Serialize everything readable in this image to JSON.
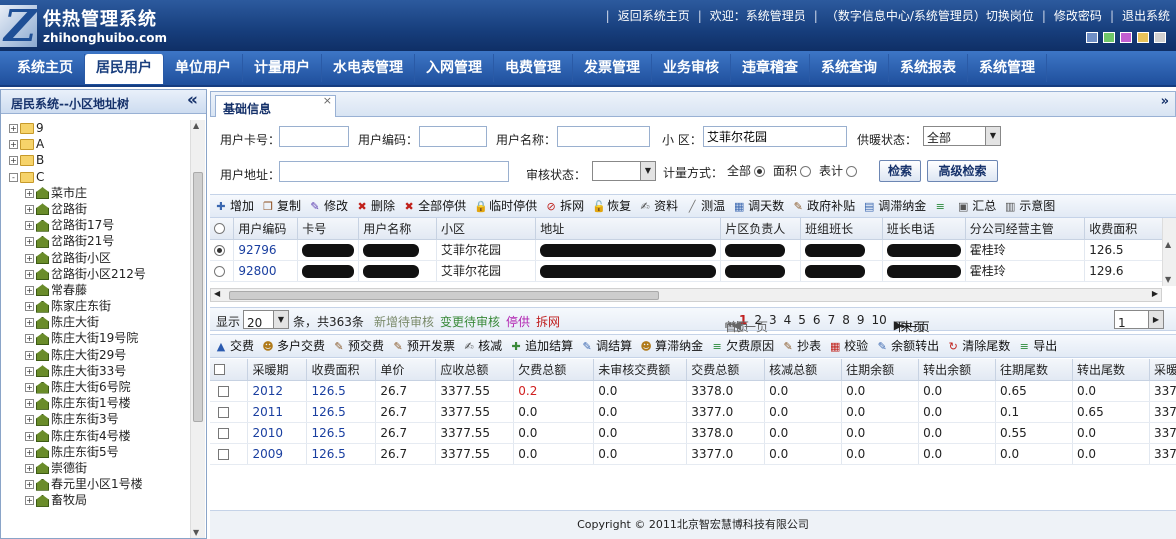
{
  "header": {
    "logo_glyph": "Z",
    "title": "供热管理系统",
    "domain": "zhihonghuibo.com",
    "links": [
      "返回系统主页",
      "欢迎：系统管理员",
      "（数字信息中心/系统管理员）切换岗位",
      "修改密码",
      "退出系统"
    ],
    "swatch_colors": [
      "#6f8fc6",
      "#6fc66a",
      "#c25fd1",
      "#e7c25b",
      "#d0d0d0"
    ]
  },
  "nav": {
    "items": [
      "系统主页",
      "居民用户",
      "单位用户",
      "计量用户",
      "水电表管理",
      "入网管理",
      "电费管理",
      "发票管理",
      "业务审核",
      "违章稽查",
      "系统查询",
      "系统报表",
      "系统管理"
    ],
    "active": "居民用户"
  },
  "sidebar": {
    "title": "居民系统--小区地址树",
    "collapse_icon": "«",
    "tree": [
      {
        "label": "9",
        "level": 0,
        "type": "folder",
        "expand": "+"
      },
      {
        "label": "A",
        "level": 0,
        "type": "folder",
        "expand": "+"
      },
      {
        "label": "B",
        "level": 0,
        "type": "folder",
        "expand": "+"
      },
      {
        "label": "C",
        "level": 0,
        "type": "folder",
        "expand": "-"
      },
      {
        "label": "菜市庄",
        "level": 1,
        "type": "house",
        "expand": "+"
      },
      {
        "label": "岔路街",
        "level": 1,
        "type": "house",
        "expand": "+"
      },
      {
        "label": "岔路街17号",
        "level": 1,
        "type": "house",
        "expand": "+"
      },
      {
        "label": "岔路街21号",
        "level": 1,
        "type": "house",
        "expand": "+"
      },
      {
        "label": "岔路街小区",
        "level": 1,
        "type": "house",
        "expand": "+"
      },
      {
        "label": "岔路街小区212号",
        "level": 1,
        "type": "house",
        "expand": "+"
      },
      {
        "label": "常春藤",
        "level": 1,
        "type": "house",
        "expand": "+"
      },
      {
        "label": "陈家庄东街",
        "level": 1,
        "type": "house",
        "expand": "+"
      },
      {
        "label": "陈庄大街",
        "level": 1,
        "type": "house",
        "expand": "+"
      },
      {
        "label": "陈庄大街19号院",
        "level": 1,
        "type": "house",
        "expand": "+"
      },
      {
        "label": "陈庄大街29号",
        "level": 1,
        "type": "house",
        "expand": "+"
      },
      {
        "label": "陈庄大街33号",
        "level": 1,
        "type": "house",
        "expand": "+"
      },
      {
        "label": "陈庄大街6号院",
        "level": 1,
        "type": "house",
        "expand": "+"
      },
      {
        "label": "陈庄东街1号楼",
        "level": 1,
        "type": "house",
        "expand": "+"
      },
      {
        "label": "陈庄东街3号",
        "level": 1,
        "type": "house",
        "expand": "+"
      },
      {
        "label": "陈庄东街4号楼",
        "level": 1,
        "type": "house",
        "expand": "+"
      },
      {
        "label": "陈庄东街5号",
        "level": 1,
        "type": "house",
        "expand": "+"
      },
      {
        "label": "崇德街",
        "level": 1,
        "type": "house",
        "expand": "+"
      },
      {
        "label": "春元里小区1号楼",
        "level": 1,
        "type": "house",
        "expand": "+"
      },
      {
        "label": "畜牧局",
        "level": 1,
        "type": "house",
        "expand": "+"
      }
    ]
  },
  "main": {
    "tab_label": "基础信息",
    "tab_close": "×",
    "collapse_icon": "»",
    "form": {
      "card_label": "用户卡号：",
      "card_value": "",
      "code_label": "用户编码：",
      "code_value": "",
      "name_label": "用户名称：",
      "name_value": "",
      "community_label": "小 区：",
      "community_value": "艾菲尔花园",
      "heating_label": "供暖状态：",
      "heating_value": "全部",
      "address_label": "用户地址：",
      "address_value": "",
      "audit_label": "审核状态：",
      "audit_value": "",
      "measure_label": "计量方式：",
      "measure_options": [
        "全部",
        "面积",
        "表计"
      ],
      "measure_selected": "全部",
      "search_button": "检索",
      "advanced_button": "高级检索"
    },
    "toolbar1": [
      {
        "label": "增加",
        "icon": "add-icon",
        "glyph": "✚",
        "color": "#3a67b0"
      },
      {
        "label": "复制",
        "icon": "copy-icon",
        "glyph": "❐",
        "color": "#8a4a1a"
      },
      {
        "label": "修改",
        "icon": "edit-icon",
        "glyph": "✎",
        "color": "#5a3ab0"
      },
      {
        "label": "删除",
        "icon": "delete-icon",
        "glyph": "✖",
        "color": "#c0201a"
      },
      {
        "label": "全部停供",
        "icon": "stop-all-icon",
        "glyph": "✖",
        "color": "#c0201a"
      },
      {
        "label": "临时停供",
        "icon": "lock-icon",
        "glyph": "🔒",
        "color": "#555"
      },
      {
        "label": "拆网",
        "icon": "forbid-icon",
        "glyph": "⊘",
        "color": "#c0201a"
      },
      {
        "label": "恢复",
        "icon": "unlock-icon",
        "glyph": "🔓",
        "color": "#555"
      },
      {
        "label": "资料",
        "icon": "info-icon",
        "glyph": "✍",
        "color": "#4a4a4a"
      },
      {
        "label": "测温",
        "icon": "thermometer-icon",
        "glyph": "╱",
        "color": "#777"
      },
      {
        "label": "调天数",
        "icon": "calendar-icon",
        "glyph": "▦",
        "color": "#3a67b0"
      },
      {
        "label": "政府补贴",
        "icon": "subsidy-icon",
        "glyph": "✎",
        "color": "#8a5a2a"
      },
      {
        "label": "调滞纳金",
        "icon": "fee-icon",
        "glyph": "▤",
        "color": "#3a67b0"
      },
      {
        "label": "",
        "icon": "list-icon",
        "glyph": "≡",
        "color": "#2a8a3a"
      },
      {
        "label": "汇总",
        "icon": "sum-icon",
        "glyph": "▣",
        "color": "#555"
      },
      {
        "label": "示意图",
        "icon": "diagram-icon",
        "glyph": "▥",
        "color": "#555"
      }
    ],
    "users": {
      "columns": [
        "",
        "用户编码",
        "卡号",
        "用户名称",
        "小区",
        "地址",
        "片区负责人",
        "班组班长",
        "班长电话",
        "分公司经营主管",
        "收费面积"
      ],
      "rows": [
        {
          "selected": true,
          "code": "92796",
          "community": "艾菲尔花园",
          "supervisor": "霍桂玲",
          "area": "126.5"
        },
        {
          "selected": false,
          "code": "92800",
          "community": "艾菲尔花园",
          "supervisor": "霍桂玲",
          "area": "129.6"
        }
      ]
    },
    "pager": {
      "show_label": "显示",
      "page_size": "20",
      "total_text": "条，共363条",
      "legend": [
        {
          "label": "新增待审核",
          "color": "#7a8a6a"
        },
        {
          "label": "变更待审核",
          "color": "#3a8a3a"
        },
        {
          "label": "停供",
          "color": "#b020b0"
        },
        {
          "label": "拆网",
          "color": "#c02020"
        }
      ],
      "first": "首页",
      "prev": "上一页",
      "pages": [
        "1",
        "2",
        "3",
        "4",
        "5",
        "6",
        "7",
        "8",
        "9",
        "10"
      ],
      "current_page": "1",
      "next": "下一页",
      "last": "末页",
      "jump_value": "1"
    },
    "toolbar2": [
      {
        "label": "交费",
        "icon": "pay-icon",
        "glyph": "▲",
        "color": "#2a5ab0"
      },
      {
        "label": "多户交费",
        "icon": "multi-pay-icon",
        "glyph": "☻",
        "color": "#b07a1a"
      },
      {
        "label": "预交费",
        "icon": "prepay-icon",
        "glyph": "✎",
        "color": "#8a5a2a"
      },
      {
        "label": "预开发票",
        "icon": "invoice-icon",
        "glyph": "✎",
        "color": "#8a5a2a"
      },
      {
        "label": "核减",
        "icon": "reduce-icon",
        "glyph": "✍",
        "color": "#4a4a4a"
      },
      {
        "label": "追加结算",
        "icon": "append-icon",
        "glyph": "✚",
        "color": "#3a8a3a"
      },
      {
        "label": "调结算",
        "icon": "adjust-icon",
        "glyph": "✎",
        "color": "#3a67b0"
      },
      {
        "label": "算滞纳金",
        "icon": "late-fee-icon",
        "glyph": "☻",
        "color": "#b07a1a"
      },
      {
        "label": "欠费原因",
        "icon": "arrears-icon",
        "glyph": "≡",
        "color": "#2a8a3a"
      },
      {
        "label": "抄表",
        "icon": "meter-icon",
        "glyph": "✎",
        "color": "#8a5a2a"
      },
      {
        "label": "校验",
        "icon": "verify-icon",
        "glyph": "▦",
        "color": "#c0201a"
      },
      {
        "label": "余额转出",
        "icon": "transfer-icon",
        "glyph": "✎",
        "color": "#3a67b0"
      },
      {
        "label": "清除尾数",
        "icon": "clear-icon",
        "glyph": "↻",
        "color": "#c0201a"
      },
      {
        "label": "导出",
        "icon": "export-icon",
        "glyph": "≡",
        "color": "#2a8a3a"
      }
    ],
    "fees": {
      "columns": [
        "",
        "采暖期",
        "收费面积",
        "单价",
        "应收总额",
        "欠费总额",
        "未审核交费额",
        "交费总额",
        "核减总额",
        "往期余额",
        "转出余额",
        "往期尾数",
        "转出尾数",
        "采暖"
      ],
      "rows": [
        [
          "2012",
          "126.5",
          "26.7",
          "3377.55",
          "0.2",
          "0.0",
          "3378.0",
          "0.0",
          "0.0",
          "0.0",
          "0.65",
          "0.0",
          "337"
        ],
        [
          "2011",
          "126.5",
          "26.7",
          "3377.55",
          "0.0",
          "0.0",
          "3377.0",
          "0.0",
          "0.0",
          "0.0",
          "0.1",
          "0.65",
          "337"
        ],
        [
          "2010",
          "126.5",
          "26.7",
          "3377.55",
          "0.0",
          "0.0",
          "3378.0",
          "0.0",
          "0.0",
          "0.0",
          "0.55",
          "0.0",
          "337"
        ],
        [
          "2009",
          "126.5",
          "26.7",
          "3377.55",
          "0.0",
          "0.0",
          "3377.0",
          "0.0",
          "0.0",
          "0.0",
          "0.0",
          "0.0",
          "337"
        ]
      ],
      "arrears_highlight_color": "#d02020"
    }
  },
  "footer": {
    "text": "Copyright © 2011北京智宏慧博科技有限公司"
  }
}
